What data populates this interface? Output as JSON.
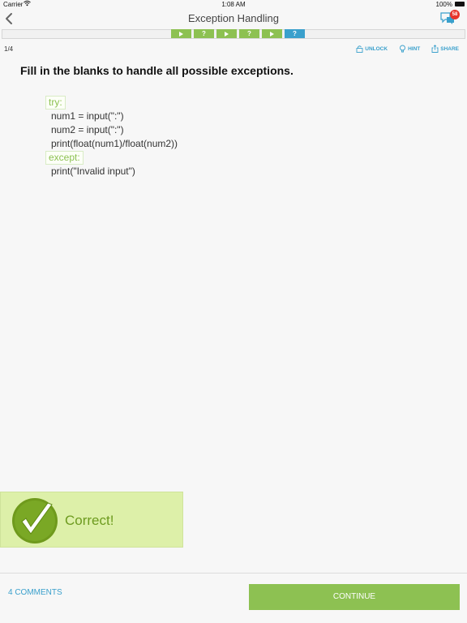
{
  "status_bar": {
    "carrier": "Carrier",
    "time": "1:08 AM",
    "battery": "100%"
  },
  "nav": {
    "title": "Exception Handling",
    "notification_count": "58"
  },
  "progress": {
    "steps": [
      {
        "label": "▶",
        "kind": "play"
      },
      {
        "label": "?",
        "kind": "quiz"
      },
      {
        "label": "▶",
        "kind": "play"
      },
      {
        "label": "?",
        "kind": "quiz"
      },
      {
        "label": "▶",
        "kind": "play"
      },
      {
        "label": "?",
        "kind": "quiz",
        "current": true
      }
    ]
  },
  "page_count": "1/4",
  "actions": {
    "unlock": "UNLOCK",
    "hint": "HINT",
    "share": "SHARE"
  },
  "question": "Fill in the blanks to handle all possible exceptions.",
  "code": {
    "blank1": "try:",
    "line1": "num1 = input(\":\")",
    "line2": "num2 = input(\":\")",
    "line3": "print(float(num1)/float(num2))",
    "blank2": "except:",
    "line4": "print(\"Invalid input\")"
  },
  "result": {
    "text": "Correct!"
  },
  "footer": {
    "comments": "4 COMMENTS",
    "continue": "CONTINUE"
  },
  "colors": {
    "accent_green": "#8dc152",
    "accent_blue": "#3aa0cc",
    "badge_red": "#e8352b",
    "banner_bg": "#ddf0a9"
  }
}
